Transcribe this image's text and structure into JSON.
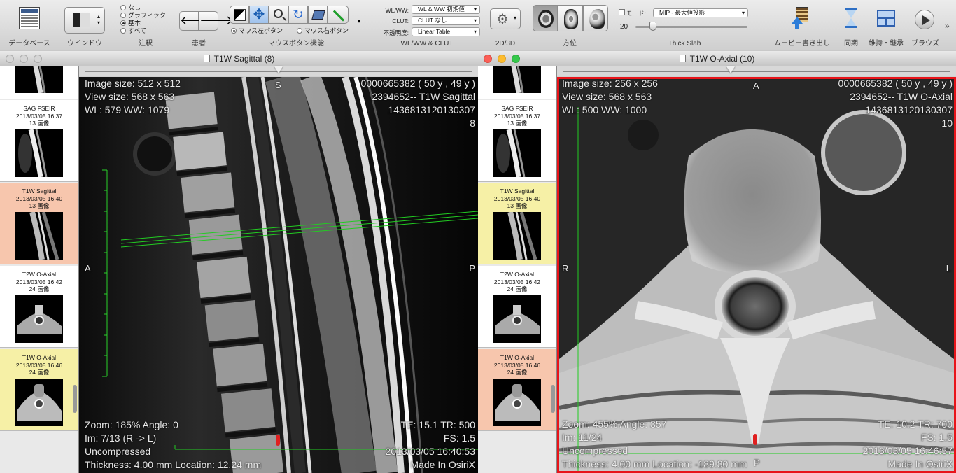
{
  "toolbar": {
    "database_label": "データベース",
    "window_label": "ウインドウ",
    "annotation_label": "注釈",
    "annotation_options": [
      "なし",
      "グラフィック",
      "基本",
      "すべて"
    ],
    "annotation_selected": 2,
    "patient_label": "患者",
    "mouse_label": "マウスボタン機能",
    "mouse_left": "マウス左ボタン",
    "mouse_right": "マウス右ボタン",
    "wlclut_label": "WL/WW & CLUT",
    "wlww_field_label": "WL/WW:",
    "wlww_value": "WL & WW 初期値",
    "clut_field_label": "CLUT:",
    "clut_value": "CLUT なし",
    "opacity_field_label": "不透明度:",
    "opacity_value": "Linear Table",
    "view2d3d_label": "2D/3D",
    "orientation_label": "方位",
    "thickslab_label": "Thick Slab",
    "mode_label": "モード:",
    "mode_value": "MIP - 最大値投影",
    "slab_value": "20",
    "movie_label": "ムービー書き出し",
    "sync_label": "同期",
    "tile_label": "維持・継承",
    "browse_label": "ブラウズ"
  },
  "left_window": {
    "title": "T1W Sagittal (8)",
    "series": [
      {
        "name": "SAG FSEIR",
        "date": "2013/03/05 16:37",
        "count": "13 画像"
      },
      {
        "name": "T1W Sagittal",
        "date": "2013/03/05 16:40",
        "count": "13 画像"
      },
      {
        "name": "T2W O-Axial",
        "date": "2013/03/05 16:42",
        "count": "24 画像"
      },
      {
        "name": "T1W O-Axial",
        "date": "2013/03/05 16:46",
        "count": "24 画像"
      }
    ],
    "overlay": {
      "tl1": "Image size: 512 x 512",
      "tl2": "View size: 568 x 563",
      "tl3": "WL: 579 WW: 1079",
      "tr1": "0000665382 ( 50 y , 49 y )",
      "tr2": "2394652-- T1W Sagittal",
      "tr3": "1436813120130307",
      "tr4": "8",
      "top_orient": "S",
      "left_orient": "A",
      "right_orient": "P",
      "bl1": "Zoom: 185% Angle: 0",
      "bl2": "Im: 7/13 (R -> L)",
      "bl3": "Uncompressed",
      "bl4": "Thickness: 4.00 mm Location: 12.24 mm",
      "br1": "TE: 15.1 TR: 500",
      "br2": "FS: 1.5",
      "br3": "2013/03/05 16:40:53",
      "br4": "Made In OsiriX"
    }
  },
  "right_window": {
    "title": "T1W O-Axial (10)",
    "series": [
      {
        "name": "SAG FSEIR",
        "date": "2013/03/05 16:37",
        "count": "13 画像"
      },
      {
        "name": "T1W Sagittal",
        "date": "2013/03/05 16:40",
        "count": "13 画像"
      },
      {
        "name": "T2W O-Axial",
        "date": "2013/03/05 16:42",
        "count": "24 画像"
      },
      {
        "name": "T1W O-Axial",
        "date": "2013/03/05 16:46",
        "count": "24 画像"
      }
    ],
    "overlay": {
      "tl1": "Image size: 256 x 256",
      "tl2": "View size: 568 x 563",
      "tl3": "WL: 500 WW: 1000",
      "tr1": "0000665382 ( 50 y , 49 y )",
      "tr2": "2394652-- T1W O-Axial",
      "tr3": "1436813120130307",
      "tr4": "10",
      "top_orient": "A",
      "left_orient": "R",
      "right_orient": "L",
      "bottom_orient": "P",
      "bl1": "Zoom: 455% Angle: 357",
      "bl2": "Im: 11/24",
      "bl3": "Uncompressed",
      "bl4": "Thickness: 4.00 mm Location: -189.80 mm",
      "br1": "TE: 10.2 TR: 700",
      "br2": "FS: 1.5",
      "br3": "2013/03/05 16:46:57",
      "br4": "Made In OsiriX"
    }
  },
  "colors": {
    "active_border": "#e8141a",
    "ref_line": "#22cc22",
    "highlight_salmon": "#f7c6ad",
    "highlight_yellow": "#f6f0a6"
  }
}
